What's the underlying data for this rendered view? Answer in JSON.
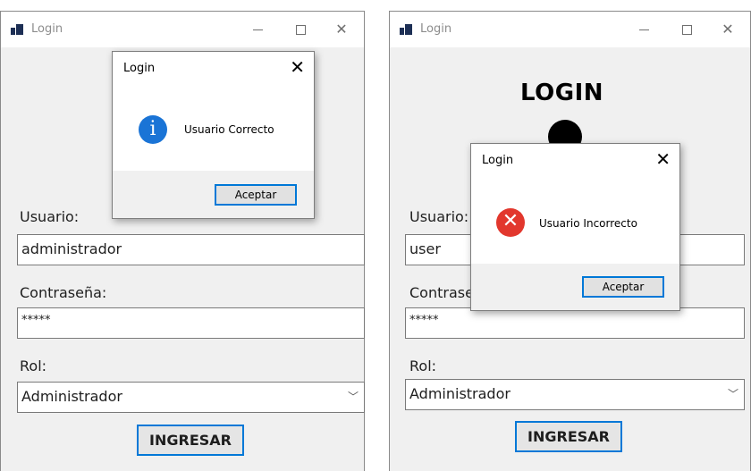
{
  "left_window": {
    "title": "Login",
    "usuario_label": "Usuario:",
    "usuario_value": "administrador",
    "password_label": "Contraseña:",
    "password_value": "*****",
    "rol_label": "Rol:",
    "rol_value": "Administrador",
    "submit_label": "INGRESAR",
    "dialog": {
      "title": "Login",
      "message": "Usuario Correcto",
      "button": "Aceptar"
    }
  },
  "right_window": {
    "title": "Login",
    "heading": "LOGIN",
    "usuario_label": "Usuario:",
    "usuario_value": "user",
    "password_label": "Contraseña:",
    "password_value": "*****",
    "rol_label": "Rol:",
    "rol_value": "Administrador",
    "submit_label": "INGRESAR",
    "dialog": {
      "title": "Login",
      "message": "Usuario Incorrecto",
      "button": "Aceptar"
    }
  },
  "icons": {
    "app": "form-icon",
    "info": "info-icon",
    "error": "error-icon",
    "close": "close-icon",
    "dropdown": "chevron-down-icon"
  },
  "colors": {
    "accent": "#0078d7",
    "info": "#1a74d6",
    "error": "#e2372d",
    "window_bg": "#f0f0f0"
  }
}
